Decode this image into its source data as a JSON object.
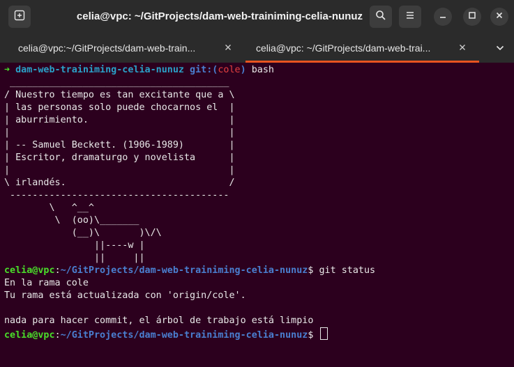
{
  "window": {
    "title": "celia@vpc: ~/GitProjects/dam-web-trainiming-celia-nunuz"
  },
  "tabs": [
    {
      "label": "celia@vpc:~/GitProjects/dam-web-train..."
    },
    {
      "label": "celia@vpc: ~/GitProjects/dam-web-trai..."
    }
  ],
  "icons": {
    "new_tab": "new-tab-icon",
    "search": "search-icon",
    "menu": "hamburger-menu-icon",
    "minimize": "minimize-icon",
    "maximize": "maximize-icon",
    "close": "close-icon",
    "tab_close": "×",
    "tab_dropdown": "chevron-down-icon"
  },
  "colors": {
    "terminal_bg": "#2c001e",
    "prompt_user": "#4ade2a",
    "prompt_path": "#4a7fd0",
    "accent": "#e95420"
  },
  "terminal": {
    "line1": {
      "arrow": "➜",
      "dir": "dam-web-trainiming-celia-nunuz",
      "git_open": "git:(",
      "branch": "cole",
      "git_close": ")",
      "cmd": "bash"
    },
    "cowsay": [
      " _______________________________________",
      "/ Nuestro tiempo es tan excitante que a \\",
      "| las personas solo puede chocarnos el  |",
      "| aburrimiento.                         |",
      "|                                       |",
      "| -- Samuel Beckett. (1906-1989)        |",
      "| Escritor, dramaturgo y novelista      |",
      "|                                       |",
      "\\ irlandés.                             /",
      " ---------------------------------------",
      "        \\   ^__^",
      "         \\  (oo)\\_______",
      "            (__)\\       )\\/\\",
      "                ||----w |",
      "                ||     ||"
    ],
    "prompt1": {
      "user": "celia@vpc",
      "sep": ":",
      "path": "~/GitProjects/dam-web-trainiming-celia-nunuz",
      "dollar": "$ ",
      "cmd": "git status"
    },
    "output": [
      "En la rama cole",
      "Tu rama está actualizada con 'origin/cole'.",
      "",
      "nada para hacer commit, el árbol de trabajo está limpio"
    ],
    "prompt2": {
      "user": "celia@vpc",
      "sep": ":",
      "path": "~/GitProjects/dam-web-trainiming-celia-nunuz",
      "dollar": "$ "
    }
  }
}
